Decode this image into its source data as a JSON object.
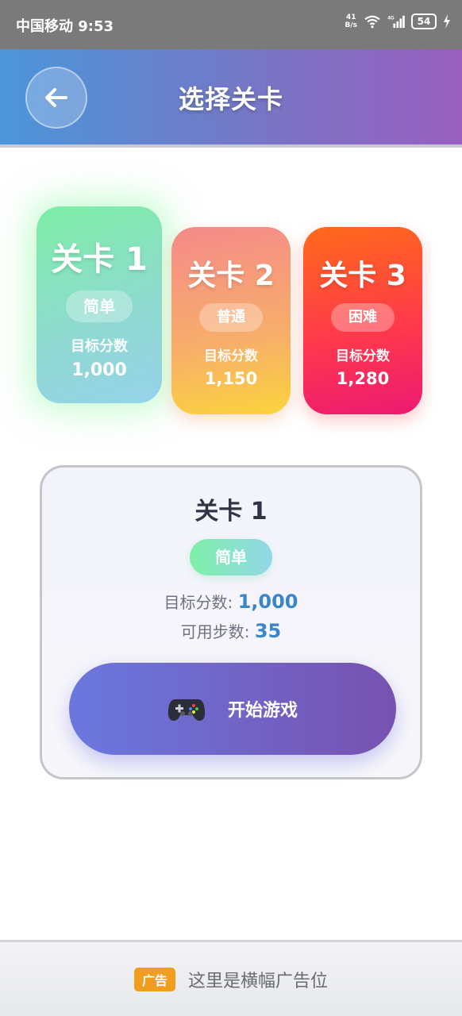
{
  "status_bar": {
    "carrier_time": "中国移动 9:53",
    "net_speed_value": "41",
    "net_speed_unit": "B/s",
    "network_type": "4G",
    "battery_level": "54"
  },
  "header": {
    "title": "选择关卡"
  },
  "levels": [
    {
      "name": "关卡 1",
      "difficulty": "简单",
      "target_label": "目标分数",
      "target": "1,000",
      "selected": true
    },
    {
      "name": "关卡 2",
      "difficulty": "普通",
      "target_label": "目标分数",
      "target": "1,150",
      "selected": false
    },
    {
      "name": "关卡 3",
      "difficulty": "困难",
      "target_label": "目标分数",
      "target": "1,280",
      "selected": false
    }
  ],
  "detail": {
    "title": "关卡 1",
    "difficulty": "简单",
    "target_label": "目标分数: ",
    "target_value": "1,000",
    "steps_label": "可用步数: ",
    "steps_value": "35",
    "start_label": "开始游戏"
  },
  "ad": {
    "tag": "广告",
    "text": "这里是横幅广告位"
  },
  "colors": {
    "header_start": "#4b96d9",
    "header_end": "#9a5fc0",
    "easy": "#7deea5",
    "normal": "#f7ae6a",
    "hard": "#ff3a4a",
    "accent_value": "#3a86c8",
    "ad_tag": "#f19e1e"
  }
}
